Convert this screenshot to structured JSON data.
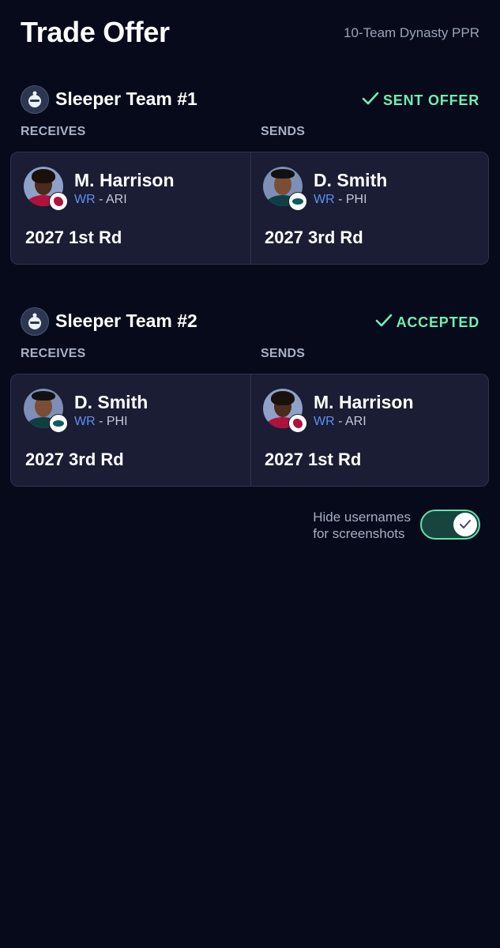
{
  "header": {
    "title": "Trade Offer",
    "subtitle": "10-Team Dynasty PPR"
  },
  "colors": {
    "background": "#060a1a",
    "card": "#1a1d33",
    "accent_green": "#6ff0b2",
    "position_blue": "#5f8ef5"
  },
  "trades": [
    {
      "team_name": "Sleeper Team #1",
      "status": "SENT OFFER",
      "receives_label": "RECEIVES",
      "sends_label": "SENDS",
      "receives": {
        "player": "M. Harrison",
        "position": "WR",
        "team": "- ARI",
        "pick": "2027 1st Rd"
      },
      "sends": {
        "player": "D. Smith",
        "position": "WR",
        "team": "- PHI",
        "pick": "2027 3rd Rd"
      }
    },
    {
      "team_name": "Sleeper Team #2",
      "status": "ACCEPTED",
      "receives_label": "RECEIVES",
      "sends_label": "SENDS",
      "receives": {
        "player": "D. Smith",
        "position": "WR",
        "team": "- PHI",
        "pick": "2027 3rd Rd"
      },
      "sends": {
        "player": "M. Harrison",
        "position": "WR",
        "team": "- ARI",
        "pick": "2027 1st Rd"
      }
    }
  ],
  "settings": {
    "hide_usernames_line1": "Hide usernames",
    "hide_usernames_line2": "for screenshots",
    "hide_usernames_enabled": true
  }
}
